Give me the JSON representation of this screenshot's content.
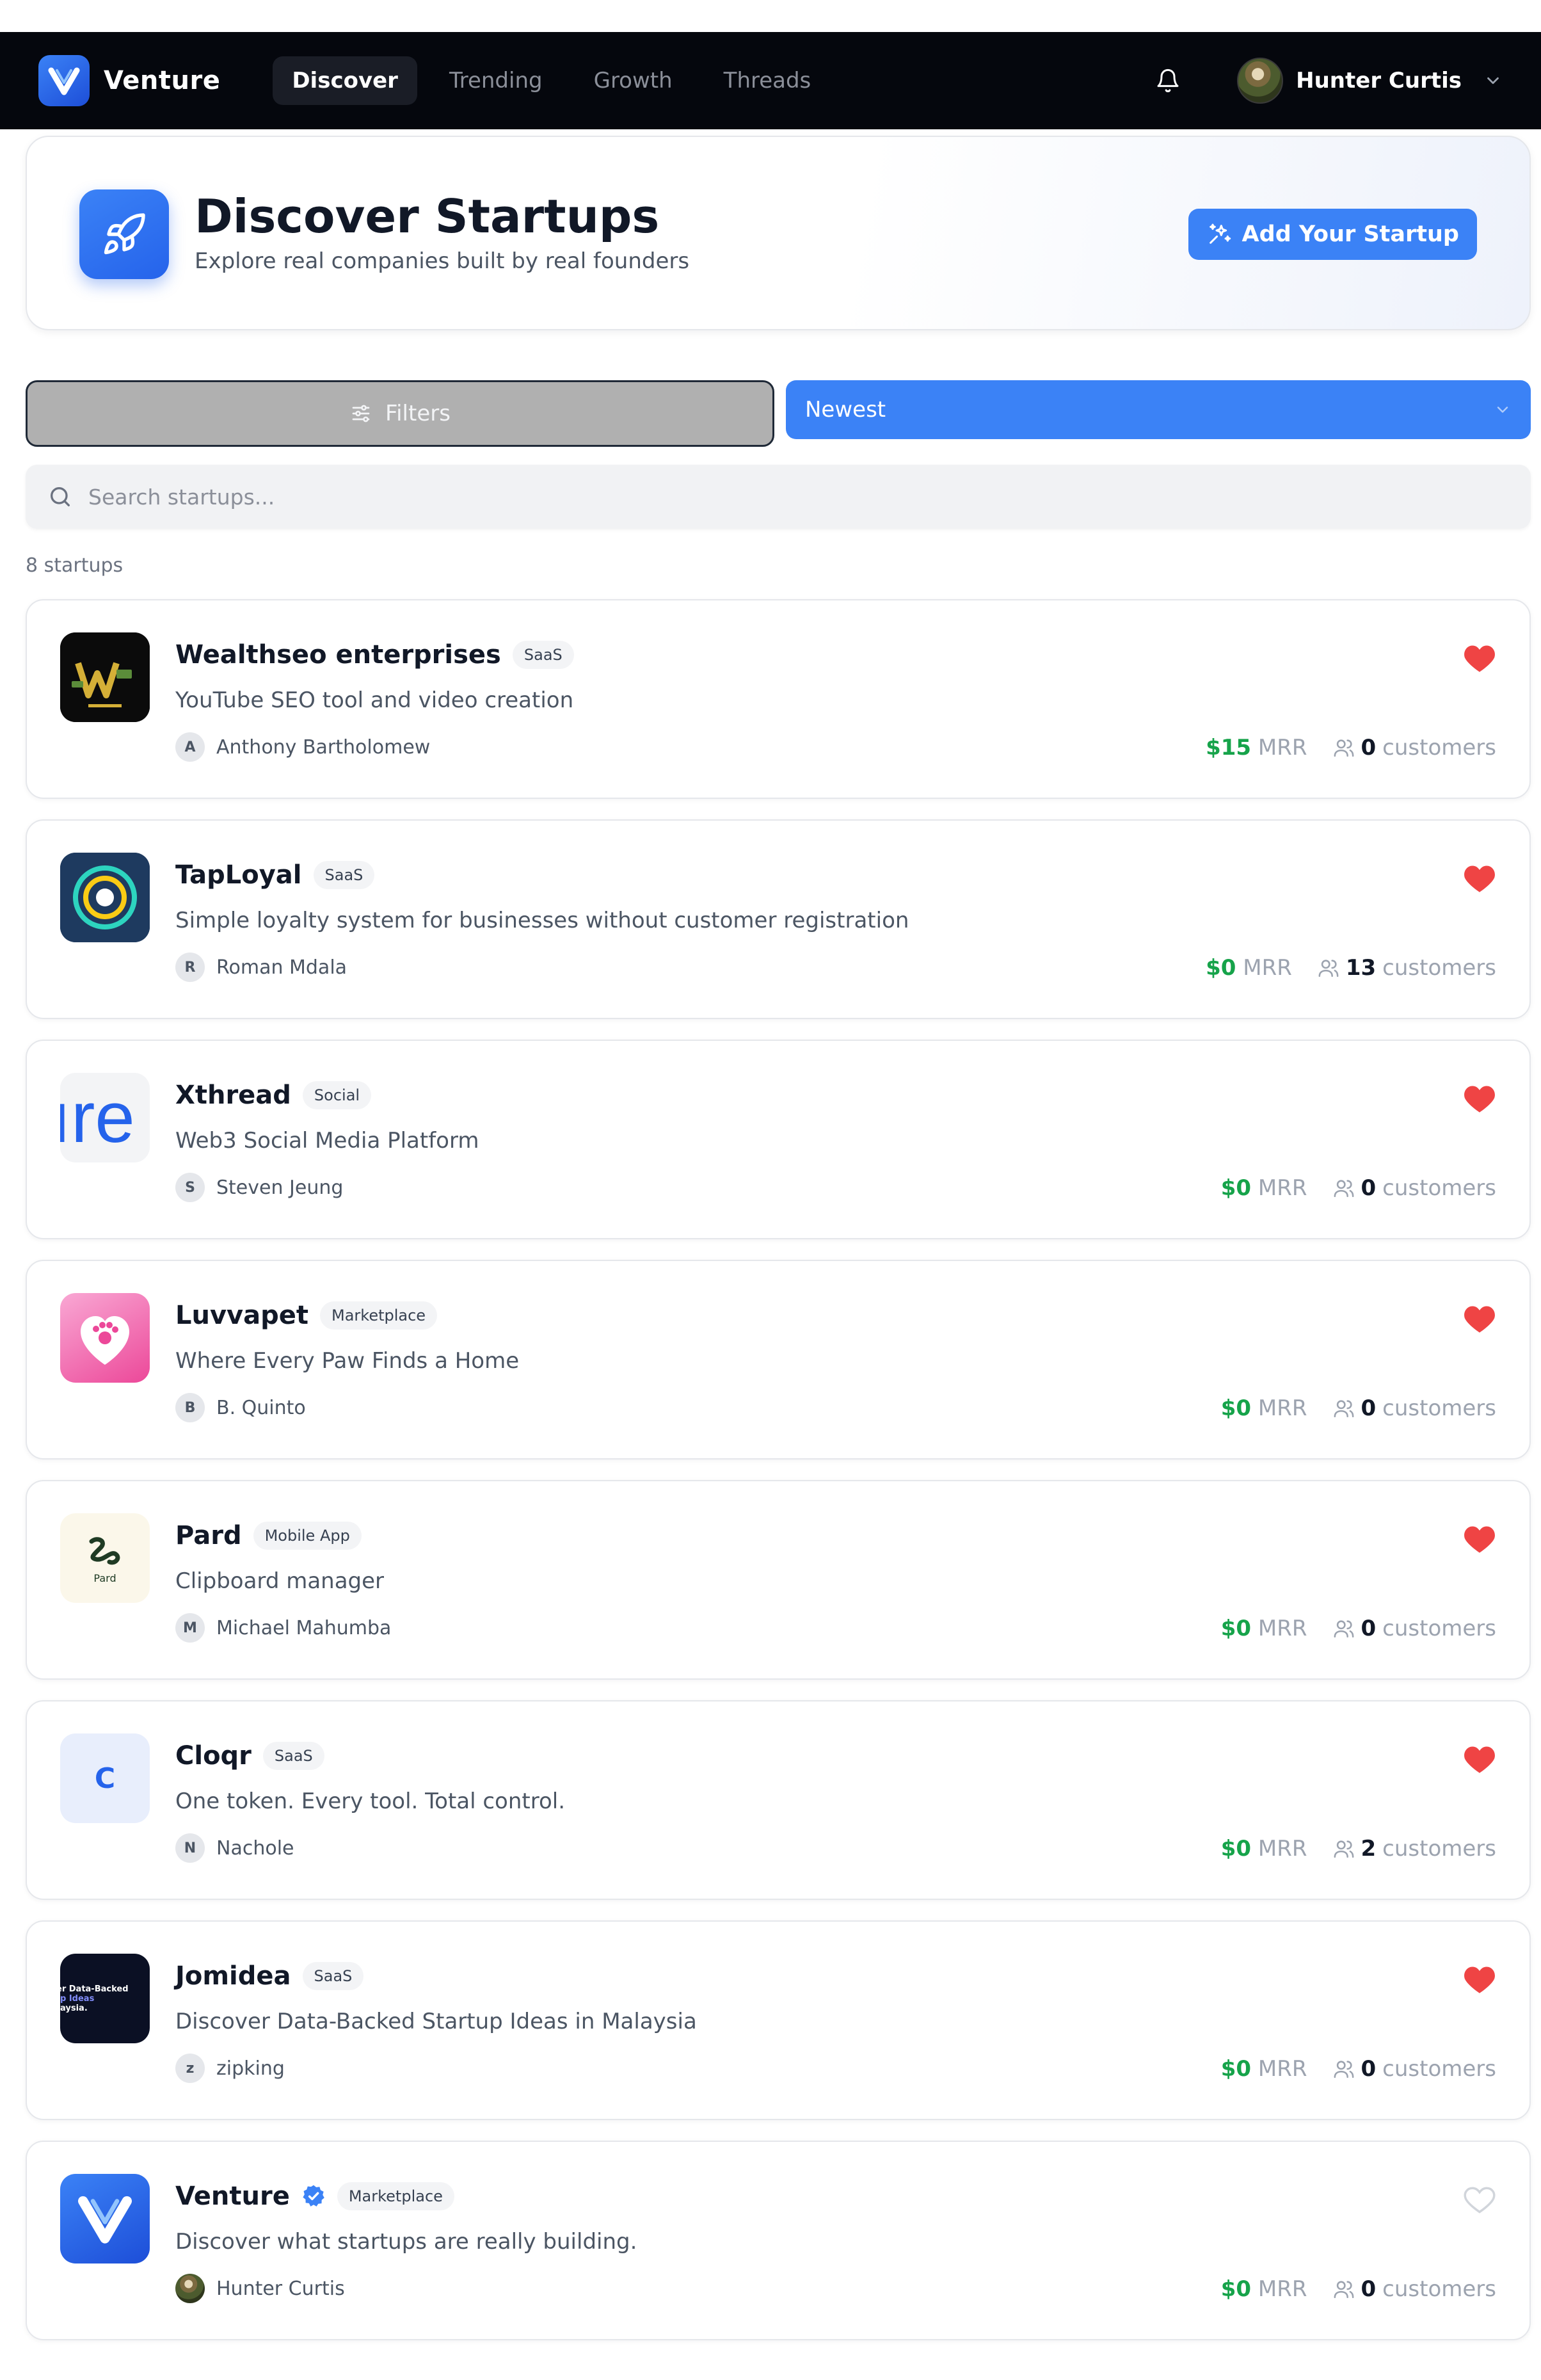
{
  "nav": {
    "brand": "Venture",
    "tabs": [
      {
        "label": "Discover",
        "active": true
      },
      {
        "label": "Trending",
        "active": false
      },
      {
        "label": "Growth",
        "active": false
      },
      {
        "label": "Threads",
        "active": false
      }
    ],
    "user_name": "Hunter Curtis",
    "icons": {
      "bell": "bell-icon",
      "caret": "chevron-down-icon"
    }
  },
  "hero": {
    "title": "Discover Startups",
    "subtitle": "Explore real companies built by real founders",
    "add_button": "Add Your Startup",
    "icon": "rocket-icon"
  },
  "controls": {
    "filters_label": "Filters",
    "sort_value": "Newest",
    "search_placeholder": "Search startups...",
    "count_label": "8 startups"
  },
  "colors": {
    "accent": "#3b82f6",
    "nav_bg": "#05070d",
    "mrr_green": "#16a34a",
    "heart_red": "#ef4444"
  },
  "startups": [
    {
      "name": "Wealthseo enterprises",
      "category": "SaaS",
      "description": "YouTube SEO tool and video creation",
      "founder_initial": "A",
      "founder": "Anthony Bartholomew",
      "mrr": "$15",
      "mrr_suffix": "MRR",
      "customers": "0",
      "customers_suffix": "customers",
      "liked": true,
      "verified": false,
      "logo": "wealthseo-logo"
    },
    {
      "name": "TapLoyal",
      "category": "SaaS",
      "description": "Simple loyalty system for businesses without customer registration",
      "founder_initial": "R",
      "founder": "Roman Mdala",
      "mrr": "$0",
      "mrr_suffix": "MRR",
      "customers": "13",
      "customers_suffix": "customers",
      "liked": true,
      "verified": false,
      "logo": "taployal-logo"
    },
    {
      "name": "Xthread",
      "category": "Social",
      "description": "Web3 Social Media Platform",
      "founder_initial": "S",
      "founder": "Steven Jeung",
      "mrr": "$0",
      "mrr_suffix": "MRR",
      "customers": "0",
      "customers_suffix": "customers",
      "liked": true,
      "verified": false,
      "logo": "xthread-logo",
      "logo_text": "ıre"
    },
    {
      "name": "Luvvapet",
      "category": "Marketplace",
      "description": "Where Every Paw Finds a Home",
      "founder_initial": "B",
      "founder": "B. Quinto",
      "mrr": "$0",
      "mrr_suffix": "MRR",
      "customers": "0",
      "customers_suffix": "customers",
      "liked": true,
      "verified": false,
      "logo": "luvvapet-logo"
    },
    {
      "name": "Pard",
      "category": "Mobile App",
      "description": "Clipboard manager",
      "founder_initial": "M",
      "founder": "Michael Mahumba",
      "mrr": "$0",
      "mrr_suffix": "MRR",
      "customers": "0",
      "customers_suffix": "customers",
      "liked": true,
      "verified": false,
      "logo": "pard-logo",
      "logo_text": "Pard"
    },
    {
      "name": "Cloqr",
      "category": "SaaS",
      "description": "One token. Every tool. Total control.",
      "founder_initial": "N",
      "founder": "Nachole",
      "mrr": "$0",
      "mrr_suffix": "MRR",
      "customers": "2",
      "customers_suffix": "customers",
      "liked": true,
      "verified": false,
      "logo": "cloqr-logo",
      "logo_text": "C"
    },
    {
      "name": "Jomidea",
      "category": "SaaS",
      "description": "Discover Data-Backed Startup Ideas in Malaysia",
      "founder_initial": "z",
      "founder": "zipking",
      "mrr": "$0",
      "mrr_suffix": "MRR",
      "customers": "0",
      "customers_suffix": "customers",
      "liked": true,
      "verified": false,
      "logo": "jomidea-logo",
      "logo_lines": [
        "er Data-Backed",
        "p Ideas",
        "aysia."
      ]
    },
    {
      "name": "Venture",
      "category": "Marketplace",
      "description": "Discover what startups are really building.",
      "founder_initial": "",
      "founder": "Hunter Curtis",
      "mrr": "$0",
      "mrr_suffix": "MRR",
      "customers": "0",
      "customers_suffix": "customers",
      "liked": false,
      "verified": true,
      "logo": "venture-logo"
    }
  ]
}
